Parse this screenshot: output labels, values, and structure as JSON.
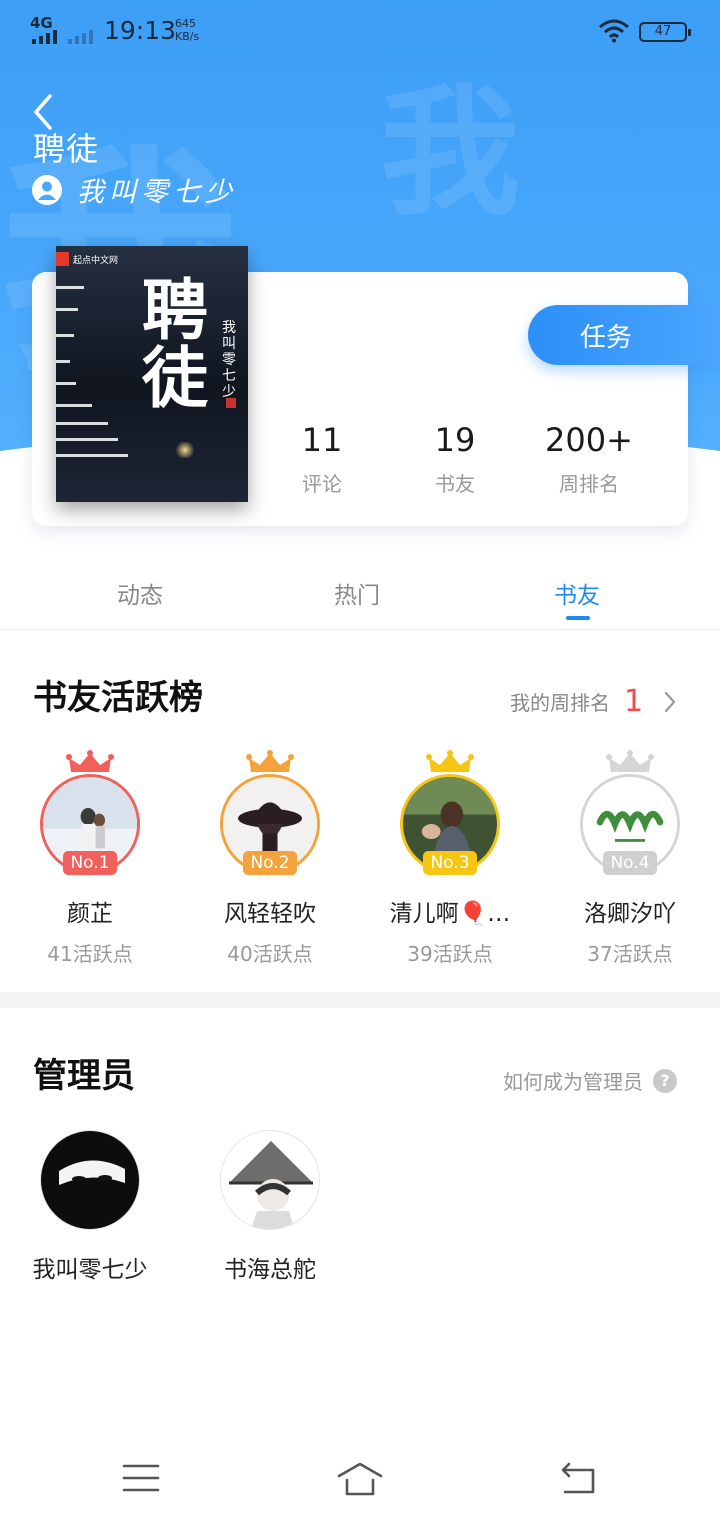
{
  "status_bar": {
    "network": "4G",
    "time": "19:13",
    "speed_value": "645",
    "speed_unit": "KB/s",
    "battery": "47"
  },
  "header": {
    "book_title": "聘徒",
    "author": "我叫零七少",
    "watermark_char": "我"
  },
  "cover": {
    "publisher": "起点中文网",
    "title": "聘徒",
    "author": "我叫零七少"
  },
  "task_button": "任务",
  "stats": [
    {
      "value": "11",
      "label": "评论"
    },
    {
      "value": "19",
      "label": "书友"
    },
    {
      "value": "200+",
      "label": "周排名"
    }
  ],
  "tabs": [
    "动态",
    "热门",
    "书友"
  ],
  "active_tab": "书友",
  "ranking": {
    "title": "书友活跃榜",
    "my_rank_label": "我的周排名",
    "my_rank_value": "1",
    "members": [
      {
        "rank": "No.1",
        "name": "颜芷",
        "points": "41活跃点",
        "color": "#f1605a"
      },
      {
        "rank": "No.2",
        "name": "风轻轻吹",
        "points": "40活跃点",
        "color": "#f4a33c"
      },
      {
        "rank": "No.3",
        "name": "清儿啊🎈…",
        "points": "39活跃点",
        "color": "#f7c513"
      },
      {
        "rank": "No.4",
        "name": "洛卿汐吖",
        "points": "37活跃点",
        "color": "#d5d5d5"
      }
    ]
  },
  "admins": {
    "title": "管理员",
    "how_to_label": "如何成为管理员",
    "help_icon": "?",
    "list": [
      {
        "name": "我叫零七少"
      },
      {
        "name": "书海总舵"
      }
    ]
  },
  "colors": {
    "accent": "#1f8bf1",
    "header_blue": "#49a8fb",
    "rank_red": "#f24a4a"
  },
  "icons": {
    "back": "chevron-left-icon",
    "author": "user-circle-icon",
    "more": "chevron-right-icon",
    "help": "question-icon",
    "nav": [
      "menu-icon",
      "home-icon",
      "back-icon"
    ]
  }
}
